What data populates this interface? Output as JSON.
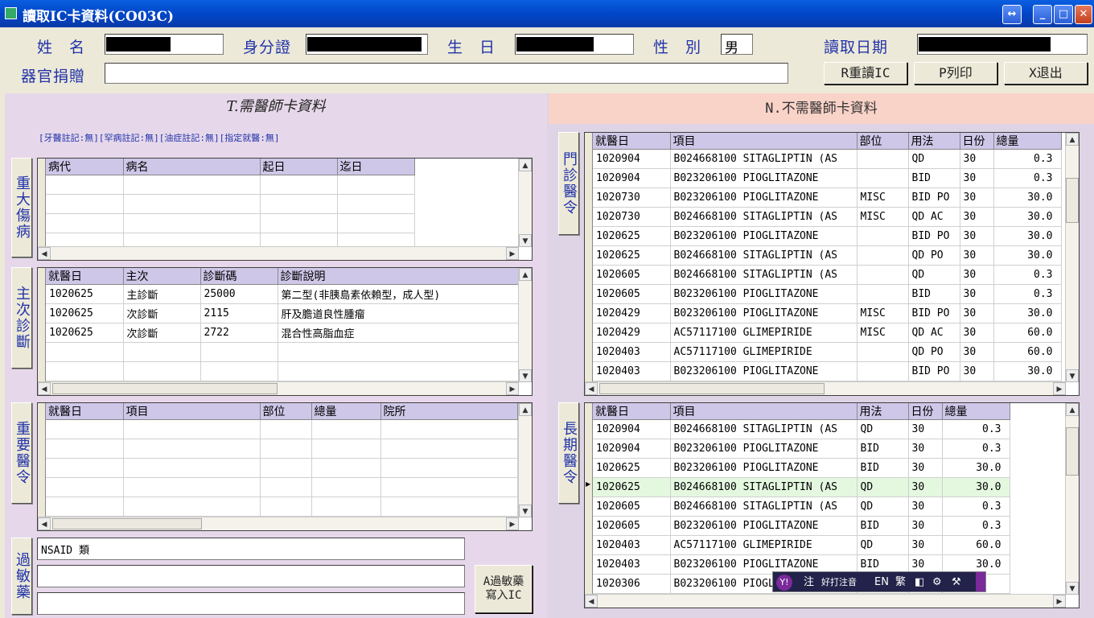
{
  "window": {
    "title": "讀取IC卡資料(CO03C)"
  },
  "header": {
    "name_label": "姓　名",
    "id_label": "身分證",
    "birth_label": "生　日",
    "sex_label": "性　別",
    "sex_value": "男",
    "readdate_label": "讀取日期",
    "organ_label": "器官捐贈",
    "organ_value": "",
    "reread_btn": "R重讀IC",
    "print_btn": "P列印",
    "exit_btn": "X退出"
  },
  "left": {
    "title": "T.需醫師卡資料",
    "flags": "[牙醫註記:無][罕病註記:無][油症註記:無][指定就醫:無]",
    "major": {
      "button": "重大傷病",
      "cols": [
        "病代",
        "病名",
        "起日",
        "迄日"
      ]
    },
    "diag": {
      "button": "主次診斷",
      "cols": [
        "就醫日",
        "主次",
        "診斷碼",
        "診斷說明"
      ],
      "rows": [
        [
          "1020625",
          "主診斷",
          "25000",
          "第二型(非胰島素依賴型，成人型)"
        ],
        [
          "1020625",
          "次診斷",
          "2115",
          "肝及膽道良性腫瘤"
        ],
        [
          "1020625",
          "次診斷",
          "2722",
          "混合性高脂血症"
        ]
      ]
    },
    "orders": {
      "button": "重要醫令",
      "cols": [
        "就醫日",
        "項目",
        "部位",
        "總量",
        "院所"
      ]
    },
    "allergy": {
      "button": "過敏藥",
      "line1": "NSAID 類",
      "line2": "",
      "line3": "",
      "write_btn_1": "A過敏藥",
      "write_btn_2": "寫入IC"
    }
  },
  "right": {
    "title": "N.不需醫師卡資料",
    "outpatient": {
      "button": "門診醫令",
      "cols": [
        "就醫日",
        "項目",
        "部位",
        "用法",
        "日份",
        "總量"
      ],
      "rows": [
        [
          "1020904",
          "B024668100 SITAGLIPTIN (AS",
          "",
          "QD",
          "30",
          "0.3"
        ],
        [
          "1020904",
          "B023206100 PIOGLITAZONE",
          "",
          "BID",
          "30",
          "0.3"
        ],
        [
          "1020730",
          "B023206100 PIOGLITAZONE",
          "MISC",
          "BID PO",
          "30",
          "30.0"
        ],
        [
          "1020730",
          "B024668100 SITAGLIPTIN (AS",
          "MISC",
          "QD AC",
          "30",
          "30.0"
        ],
        [
          "1020625",
          "B023206100 PIOGLITAZONE",
          "",
          "BID PO",
          "30",
          "30.0"
        ],
        [
          "1020625",
          "B024668100 SITAGLIPTIN (AS",
          "",
          "QD  PO",
          "30",
          "30.0"
        ],
        [
          "1020605",
          "B024668100 SITAGLIPTIN (AS",
          "",
          "QD",
          "30",
          "0.3"
        ],
        [
          "1020605",
          "B023206100 PIOGLITAZONE",
          "",
          "BID",
          "30",
          "0.3"
        ],
        [
          "1020429",
          "B023206100 PIOGLITAZONE",
          "MISC",
          "BID PO",
          "30",
          "30.0"
        ],
        [
          "1020429",
          "AC57117100 GLIMEPIRIDE",
          "MISC",
          "QD AC",
          "30",
          "60.0"
        ],
        [
          "1020403",
          "AC57117100 GLIMEPIRIDE",
          "",
          "QD  PO",
          "30",
          "60.0"
        ],
        [
          "1020403",
          "B023206100 PIOGLITAZONE",
          "",
          "BID PO",
          "30",
          "30.0"
        ]
      ]
    },
    "longterm": {
      "button": "長期醫令",
      "cols": [
        "就醫日",
        "項目",
        "用法",
        "日份",
        "總量"
      ],
      "rows": [
        [
          "1020904",
          "B024668100 SITAGLIPTIN (AS",
          "QD",
          "30",
          "0.3"
        ],
        [
          "1020904",
          "B023206100 PIOGLITAZONE",
          "BID",
          "30",
          "0.3"
        ],
        [
          "1020625",
          "B023206100 PIOGLITAZONE",
          "BID",
          "30",
          "30.0"
        ],
        [
          "1020625",
          "B024668100 SITAGLIPTIN (AS",
          "QD",
          "30",
          "30.0"
        ],
        [
          "1020605",
          "B024668100 SITAGLIPTIN (AS",
          "QD",
          "30",
          "0.3"
        ],
        [
          "1020605",
          "B023206100 PIOGLITAZONE",
          "BID",
          "30",
          "0.3"
        ],
        [
          "1020403",
          "AC57117100 GLIMEPIRIDE",
          "QD",
          "30",
          "60.0"
        ],
        [
          "1020403",
          "B023206100 PIOGLITAZONE",
          "BID",
          "30",
          "30.0"
        ],
        [
          "1020306",
          "B023206100 PIOGL",
          "",
          "",
          ""
        ]
      ]
    }
  },
  "ime": {
    "items": [
      "注",
      "好打注音",
      "EN",
      "繁"
    ]
  }
}
